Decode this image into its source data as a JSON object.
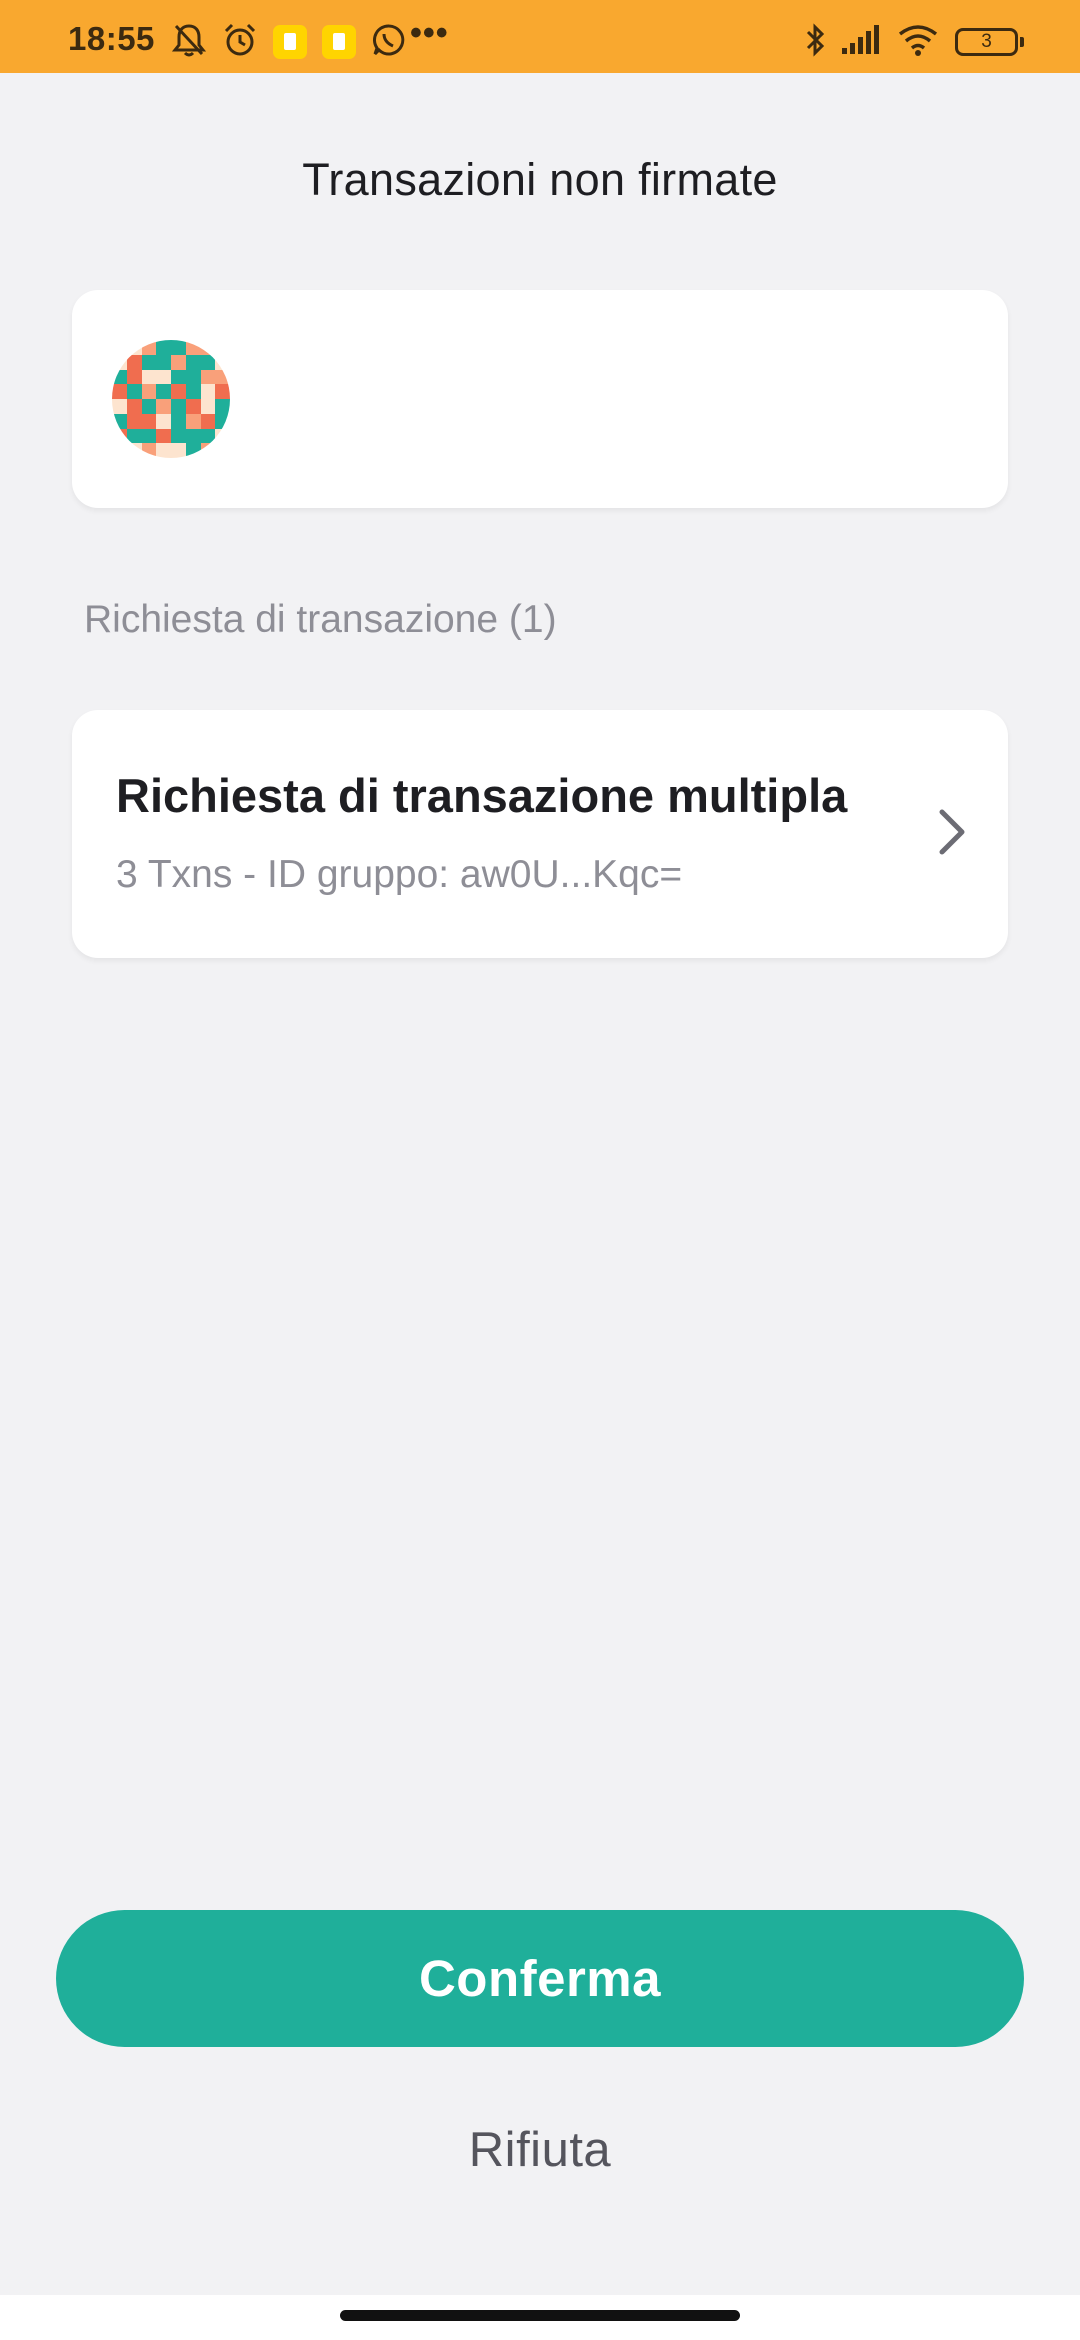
{
  "status_bar": {
    "time": "18:55",
    "dots": "•••",
    "battery_level": "3",
    "background": "#f9a82f",
    "icons": [
      "bell-off-icon",
      "alarm-icon",
      "app-notification-icon",
      "app-notification-icon",
      "whatsapp-icon",
      "bluetooth-icon",
      "signal-icon",
      "wifi-icon",
      "battery-icon"
    ]
  },
  "header": {
    "title": "Transazioni non firmate"
  },
  "account_card": {
    "avatar_icon": "identicon-avatar",
    "avatar_colors": [
      "#1faf9a",
      "#f06d4f",
      "#fde4cf",
      "#f9a07a"
    ]
  },
  "requests": {
    "section_label": "Richiesta di transazione (1)",
    "items": [
      {
        "title": "Richiesta di transazione multipla",
        "subtitle": "3 Txns - ID gruppo: aw0U...Kqc=",
        "icon": "chevron-right-icon"
      }
    ]
  },
  "actions": {
    "confirm_label": "Conferma",
    "reject_label": "Rifiuta",
    "accent": "#1faf9a"
  }
}
